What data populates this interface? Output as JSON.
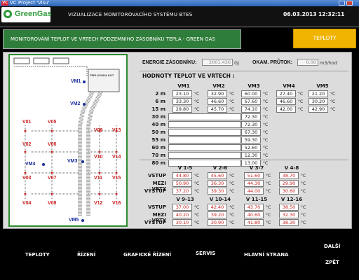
{
  "window": {
    "title": "VC Project 'Visu'",
    "icon_text": "VC"
  },
  "header": {
    "logo_text": "GreenGas",
    "title": "VIZUALIZACE MONITOROVACÍHO SYSTÉMU BTES",
    "datetime": "06.03.2013 12:32:11"
  },
  "page": {
    "title": "MONITOROVÁNÍ TEPLOT VE VRTECH PODZEMNÍHO ZÁSOBNÍKU TEPLA - GREEN GAS",
    "teploty_button": "TEPLOTY"
  },
  "diagram": {
    "labels": {
      "vm1": "VM1",
      "vm2": "VM2",
      "vm3": "VM3",
      "vm4": "VM4",
      "vm5": "VM5",
      "v01": "V01",
      "v02": "V02",
      "v03": "V03",
      "v04": "V04",
      "v05": "V05",
      "v06": "V06",
      "v07": "V07",
      "v08": "V08",
      "v09": "V09",
      "v10": "V10",
      "v11": "V11",
      "v12": "V12",
      "v13": "V13",
      "v14": "V14",
      "v15": "V15",
      "v16": "V16"
    },
    "tank_label": "TEPLOVODA KOT"
  },
  "stats": {
    "energie_label": "ENERGIE ZÁSOBNÍKU:",
    "energie_value": "2001.430",
    "energie_unit": "GJ",
    "prutok_label": "OKAM. PRŮTOK:",
    "prutok_value": "0.00",
    "prutok_unit": "m3/hod"
  },
  "wells": {
    "section_title": "HODNOTY TEPLOT VE VRTECH :",
    "columns": [
      "VM1",
      "VM2",
      "VM3",
      "VM4",
      "VM5"
    ],
    "unit": "°C",
    "rows": [
      {
        "depth": "2 m",
        "values": [
          "23.10",
          "32.90",
          "60.00",
          "27.40",
          "21.20"
        ]
      },
      {
        "depth": "6 m",
        "values": [
          "33.30",
          "46.60",
          "67.60",
          "46.60",
          "30.20"
        ]
      },
      {
        "depth": "15 m",
        "values": [
          "29.80",
          "45.70",
          "74.10",
          "42.00",
          "42.90"
        ]
      }
    ],
    "deep_rows": [
      {
        "depth": "30 m",
        "value": "72.30"
      },
      {
        "depth": "40 m",
        "value": "72.30"
      },
      {
        "depth": "50 m",
        "value": "67.30"
      },
      {
        "depth": "55 m",
        "value": "59.30"
      },
      {
        "depth": "60 m",
        "value": "52.60"
      },
      {
        "depth": "70 m",
        "value": "12.30"
      },
      {
        "depth": "80 m",
        "value": "13.00"
      }
    ]
  },
  "groups": {
    "columns1": [
      "V 1-5",
      "V 2-6",
      "V 3-7",
      "V 4-8"
    ],
    "columns2": [
      "V 9-13",
      "V 10-14",
      "V 11-15",
      "V 12-16"
    ],
    "row_labels": [
      "VSTUP",
      "MEZI VRTY",
      "VÝSTUP"
    ],
    "unit": "°C",
    "block1": [
      [
        "44.80",
        "45.60",
        "51.60",
        "38.70"
      ],
      [
        "50.90",
        "36.30",
        "44.30",
        "29.90"
      ],
      [
        "37.20",
        "39.30",
        "44.00",
        "30.60"
      ]
    ],
    "block2": [
      [
        "37.00",
        "42.40",
        "43.70",
        "38.50"
      ],
      [
        "40.20",
        "39.20",
        "40.60",
        "32.30"
      ],
      [
        "30.10",
        "30.90",
        "41.80",
        "38.30"
      ]
    ]
  },
  "nav": {
    "teploty": "TEPLOTY",
    "rizeni": "ŘÍZENÍ",
    "graficke": "GRAFICKÉ ŘÍZENÍ",
    "servis": "SERVIS",
    "hlavni": "HLAVNÍ STRANA",
    "dalsi": "DALŠÍ",
    "zpet": "ZPĚT"
  }
}
